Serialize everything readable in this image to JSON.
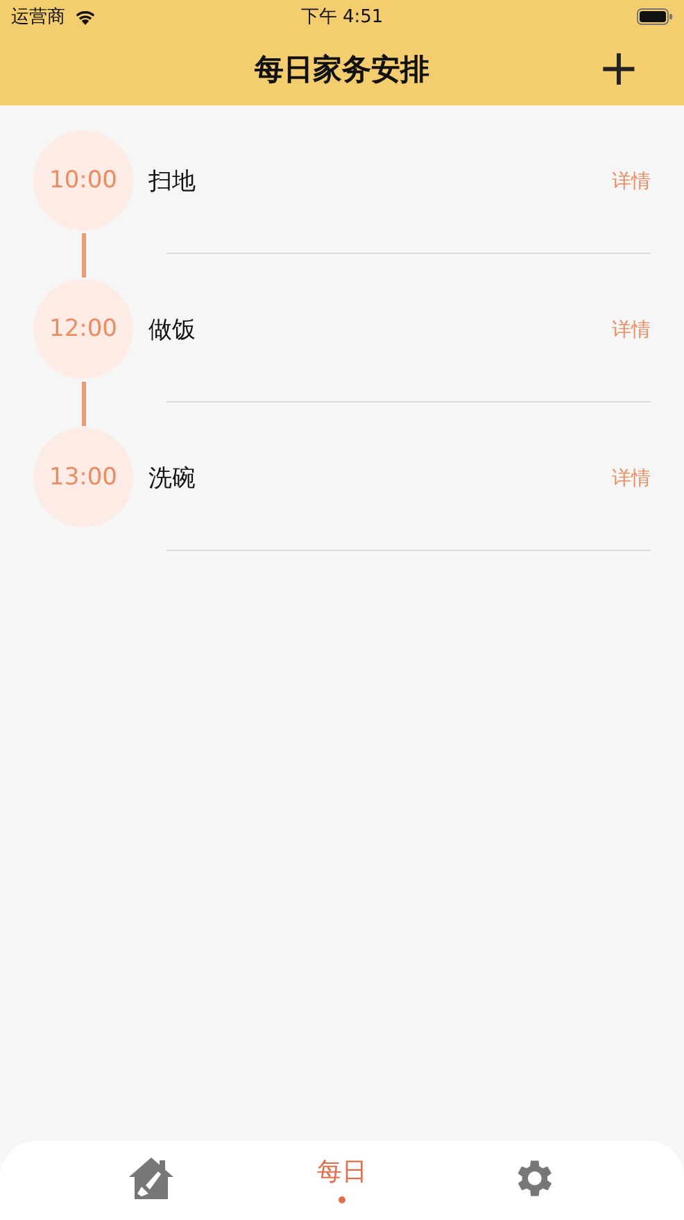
{
  "status_bar": {
    "carrier": "运营商",
    "time": "下午 4:51"
  },
  "header": {
    "title": "每日家务安排",
    "add_button": "+"
  },
  "tasks": [
    {
      "time": "10:00",
      "name": "扫地",
      "action": "详情"
    },
    {
      "time": "12:00",
      "name": "做饭",
      "action": "详情"
    },
    {
      "time": "13:00",
      "name": "洗碗",
      "action": "详情"
    }
  ],
  "tab_bar": [
    {
      "kind": "home",
      "selected": false
    },
    {
      "kind": "text",
      "label": "每日",
      "selected": true
    },
    {
      "kind": "settings",
      "selected": false
    }
  ]
}
